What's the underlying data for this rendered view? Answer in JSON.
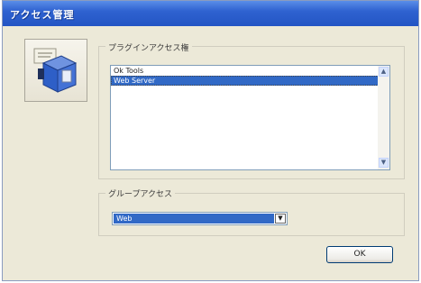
{
  "window": {
    "title": "アクセス管理"
  },
  "icon": {
    "name": "access-permission-icon"
  },
  "plugin_access": {
    "label": "プラグインアクセス権",
    "items": [
      {
        "label": "Ok Tools",
        "selected": false
      },
      {
        "label": "Web Server",
        "selected": true
      }
    ]
  },
  "group_access": {
    "label": "グループアクセス",
    "value": "Web"
  },
  "buttons": {
    "ok": "OK"
  },
  "colors": {
    "titlebar": "#2f62d0",
    "selection": "#3169c6",
    "dialog_bg": "#ece9d8"
  }
}
